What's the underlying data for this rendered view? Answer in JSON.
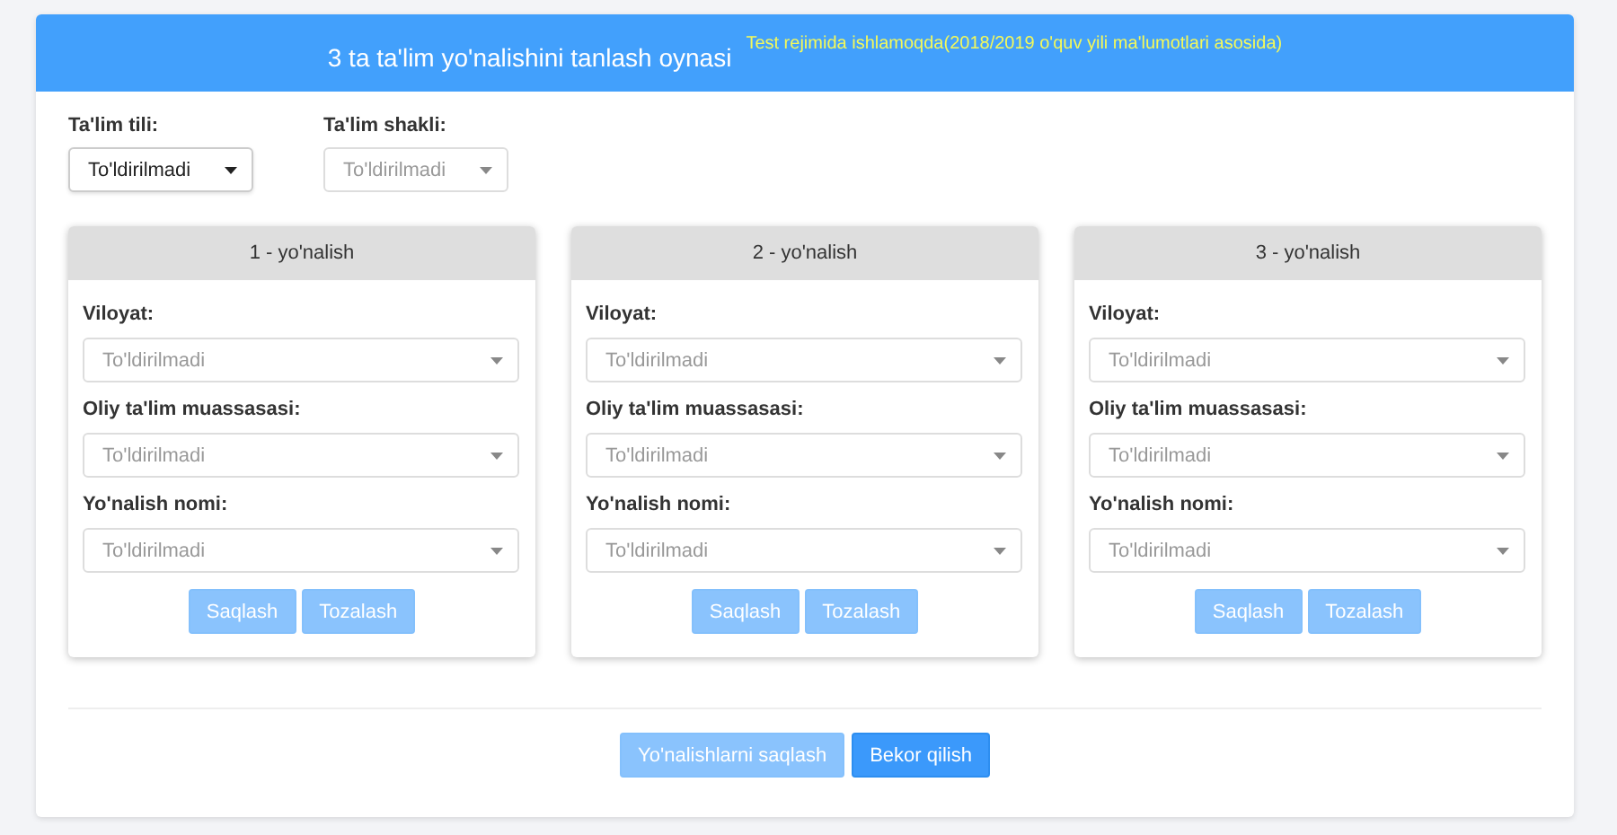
{
  "header": {
    "title": "3 ta ta'lim yo'nalishini tanlash oynasi",
    "notice": "Test rejimida ishlamoqda(2018/2019 o'quv yili ma'lumotlari asosida)"
  },
  "filters": [
    {
      "label": "Ta'lim tili:",
      "value": "To'ldirilmadi",
      "disabled": false
    },
    {
      "label": "Ta'lim shakli:",
      "value": "To'ldirilmadi",
      "disabled": true
    }
  ],
  "cards": [
    {
      "title": "1 - yo'nalish",
      "fields": [
        {
          "label": "Viloyat:",
          "value": "To'ldirilmadi",
          "disabled": true
        },
        {
          "label": "Oliy ta'lim muassasasi:",
          "value": "To'ldirilmadi",
          "disabled": true
        },
        {
          "label": "Yo'nalish nomi:",
          "value": "To'ldirilmadi",
          "disabled": true
        }
      ],
      "buttons": [
        {
          "label": "Saqlash",
          "disabled": true
        },
        {
          "label": "Tozalash",
          "disabled": true
        }
      ]
    },
    {
      "title": "2 - yo'nalish",
      "fields": [
        {
          "label": "Viloyat:",
          "value": "To'ldirilmadi",
          "disabled": true
        },
        {
          "label": "Oliy ta'lim muassasasi:",
          "value": "To'ldirilmadi",
          "disabled": true
        },
        {
          "label": "Yo'nalish nomi:",
          "value": "To'ldirilmadi",
          "disabled": true
        }
      ],
      "buttons": [
        {
          "label": "Saqlash",
          "disabled": true
        },
        {
          "label": "Tozalash",
          "disabled": true
        }
      ]
    },
    {
      "title": "3 - yo'nalish",
      "fields": [
        {
          "label": "Viloyat:",
          "value": "To'ldirilmadi",
          "disabled": true
        },
        {
          "label": "Oliy ta'lim muassasasi:",
          "value": "To'ldirilmadi",
          "disabled": true
        },
        {
          "label": "Yo'nalish nomi:",
          "value": "To'ldirilmadi",
          "disabled": true
        }
      ],
      "buttons": [
        {
          "label": "Saqlash",
          "disabled": true
        },
        {
          "label": "Tozalash",
          "disabled": true
        }
      ]
    }
  ],
  "footer_buttons": [
    {
      "label": "Yo'nalishlarni saqlash",
      "disabled": true
    },
    {
      "label": "Bekor qilish",
      "disabled": false
    }
  ]
}
